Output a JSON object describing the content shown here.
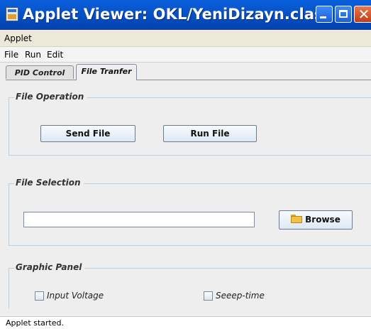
{
  "window": {
    "title": "Applet Viewer: OKL/YeniDizayn.class",
    "icon": "applet-icon",
    "controls": [
      "minimize-icon",
      "maximize-icon",
      "close-icon"
    ]
  },
  "applet_menu": {
    "label": "Applet"
  },
  "menubar": {
    "items": [
      "File",
      "Run",
      "Edit"
    ]
  },
  "tabs": [
    {
      "label": "PID Control",
      "selected": false
    },
    {
      "label": "File Tranfer",
      "selected": true
    }
  ],
  "file_operation": {
    "title": "File Operation",
    "send_button": "Send File",
    "run_button": "Run File"
  },
  "file_selection": {
    "title": "File Selection",
    "path_value": "",
    "browse_button": "Browse",
    "browse_icon": "folder-icon"
  },
  "graphic_panel": {
    "title": "Graphic Panel",
    "checkboxes": [
      {
        "label": "Input Voltage",
        "checked": false
      },
      {
        "label": "Seeep-time",
        "checked": false
      }
    ]
  },
  "status": {
    "text": "Applet started."
  },
  "colors": {
    "titlebar": "#0553c8",
    "close_button": "#d9532a",
    "group_border": "#b8cfe5",
    "panel_background": "#eeeeee"
  }
}
